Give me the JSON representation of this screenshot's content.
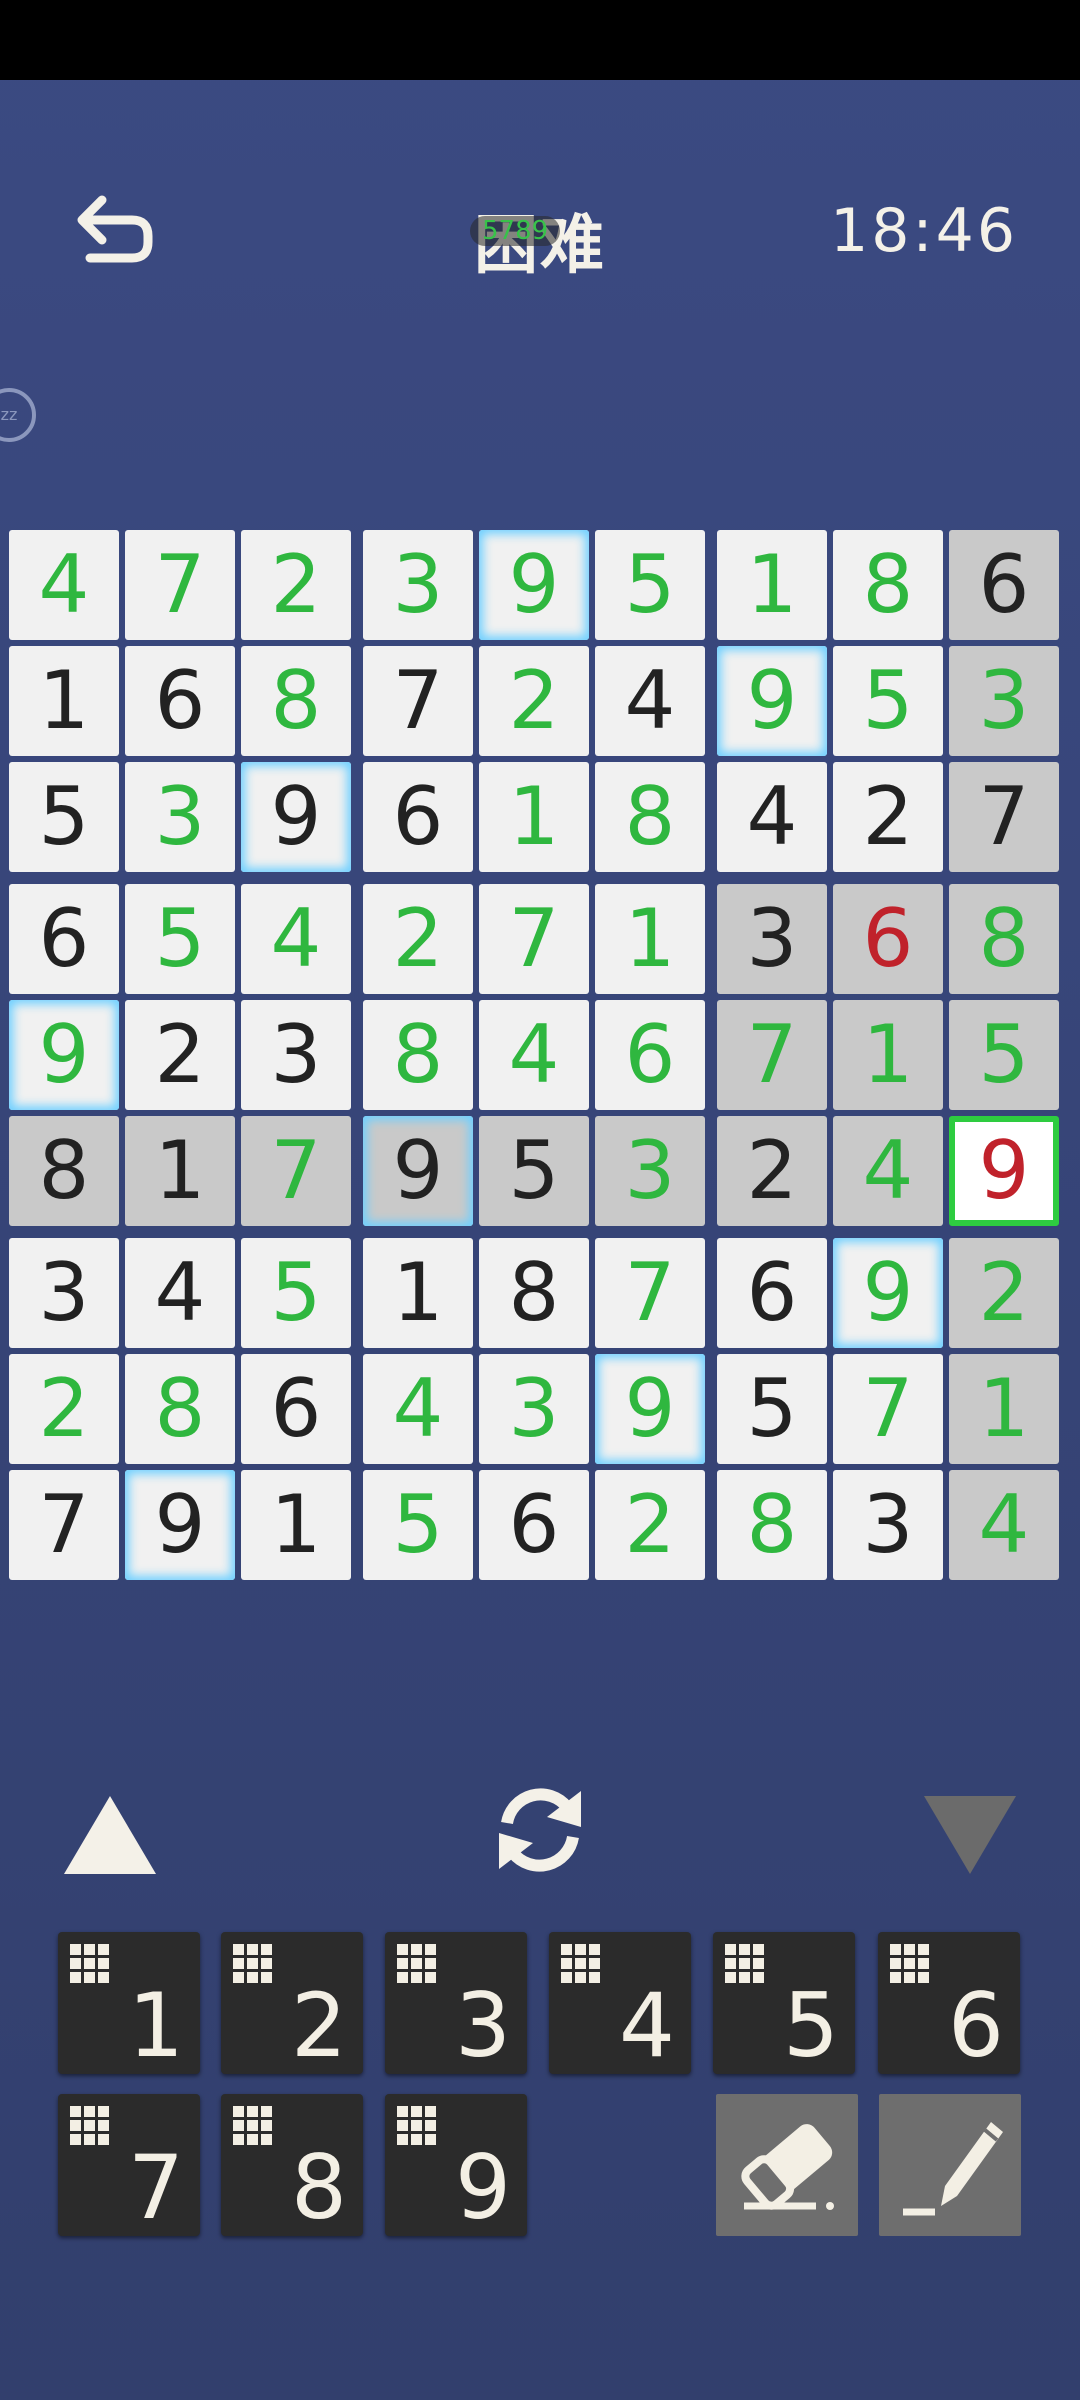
{
  "header": {
    "title": "困难",
    "title_overlay": "5789",
    "timer": "18:46",
    "zz_badge": "zz"
  },
  "icons": {
    "back": "back-arrow-icon",
    "prev": "triangle-up-icon",
    "refresh": "refresh-icon",
    "next": "triangle-down-icon",
    "eraser": "eraser-icon",
    "pencil": "pencil-icon"
  },
  "board": {
    "digits": [
      [
        "4",
        "7",
        "2",
        "3",
        "9",
        "5",
        "1",
        "8",
        "6"
      ],
      [
        "1",
        "6",
        "8",
        "7",
        "2",
        "4",
        "9",
        "5",
        "3"
      ],
      [
        "5",
        "3",
        "9",
        "6",
        "1",
        "8",
        "4",
        "2",
        "7"
      ],
      [
        "6",
        "5",
        "4",
        "2",
        "7",
        "1",
        "3",
        "6",
        "8"
      ],
      [
        "9",
        "2",
        "3",
        "8",
        "4",
        "6",
        "7",
        "1",
        "5"
      ],
      [
        "8",
        "1",
        "7",
        "9",
        "5",
        "3",
        "2",
        "4",
        "9"
      ],
      [
        "3",
        "4",
        "5",
        "1",
        "8",
        "7",
        "6",
        "9",
        "2"
      ],
      [
        "2",
        "8",
        "6",
        "4",
        "3",
        "9",
        "5",
        "7",
        "1"
      ],
      [
        "7",
        "9",
        "1",
        "5",
        "6",
        "2",
        "8",
        "3",
        "4"
      ]
    ],
    "kinds": [
      [
        "u",
        "u",
        "u",
        "u",
        "u",
        "u",
        "u",
        "u",
        "g"
      ],
      [
        "g",
        "g",
        "u",
        "g",
        "u",
        "g",
        "u",
        "u",
        "u"
      ],
      [
        "g",
        "u",
        "g",
        "g",
        "u",
        "u",
        "g",
        "g",
        "g"
      ],
      [
        "g",
        "u",
        "u",
        "u",
        "u",
        "u",
        "g",
        "e",
        "u"
      ],
      [
        "u",
        "g",
        "g",
        "u",
        "u",
        "u",
        "u",
        "u",
        "u"
      ],
      [
        "g",
        "g",
        "u",
        "g",
        "g",
        "u",
        "g",
        "u",
        "e"
      ],
      [
        "g",
        "g",
        "u",
        "g",
        "g",
        "u",
        "g",
        "u",
        "u"
      ],
      [
        "u",
        "u",
        "g",
        "u",
        "u",
        "u",
        "g",
        "u",
        "u"
      ],
      [
        "g",
        "g",
        "g",
        "u",
        "g",
        "u",
        "u",
        "g",
        "u"
      ]
    ],
    "shaded": [
      [
        0,
        0,
        0,
        0,
        0,
        0,
        0,
        0,
        1
      ],
      [
        0,
        0,
        0,
        0,
        0,
        0,
        0,
        0,
        1
      ],
      [
        0,
        0,
        0,
        0,
        0,
        0,
        0,
        0,
        1
      ],
      [
        0,
        0,
        0,
        0,
        0,
        0,
        1,
        1,
        1
      ],
      [
        0,
        0,
        0,
        0,
        0,
        0,
        1,
        1,
        1
      ],
      [
        1,
        1,
        1,
        1,
        1,
        1,
        1,
        1,
        0
      ],
      [
        0,
        0,
        0,
        0,
        0,
        0,
        0,
        0,
        1
      ],
      [
        0,
        0,
        0,
        0,
        0,
        0,
        0,
        0,
        1
      ],
      [
        0,
        0,
        0,
        0,
        0,
        0,
        0,
        0,
        1
      ]
    ],
    "glow": [
      [
        0,
        0,
        0,
        0,
        1,
        0,
        0,
        0,
        0
      ],
      [
        0,
        0,
        0,
        0,
        0,
        0,
        1,
        0,
        0
      ],
      [
        0,
        0,
        1,
        0,
        0,
        0,
        0,
        0,
        0
      ],
      [
        0,
        0,
        0,
        0,
        0,
        0,
        0,
        0,
        0
      ],
      [
        1,
        0,
        0,
        0,
        0,
        0,
        0,
        0,
        0
      ],
      [
        0,
        0,
        0,
        1,
        0,
        0,
        0,
        0,
        0
      ],
      [
        0,
        0,
        0,
        0,
        0,
        0,
        0,
        1,
        0
      ],
      [
        0,
        0,
        0,
        0,
        0,
        1,
        0,
        0,
        0
      ],
      [
        0,
        1,
        0,
        0,
        0,
        0,
        0,
        0,
        0
      ]
    ],
    "selected": [
      5,
      8
    ],
    "colors": {
      "given": "#222222",
      "user": "#2fb73f",
      "error": "#c0222b",
      "cell": "#f1f1f1",
      "shade": "#c9c9c9",
      "glow": "#6fd0ff",
      "selected_border": "#2ecc40"
    }
  },
  "numpad": {
    "keys": [
      "1",
      "2",
      "3",
      "4",
      "5",
      "6",
      "7",
      "8",
      "9"
    ]
  },
  "theme": {
    "background": "#36457a",
    "key_background": "#2b2b2b",
    "tool_background": "#6e6e6e"
  }
}
